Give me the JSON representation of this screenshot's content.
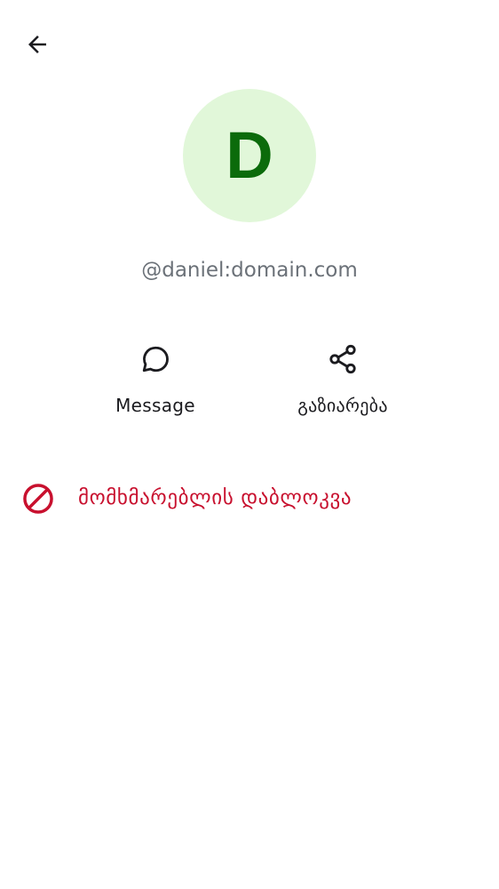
{
  "header": {
    "back_icon": "arrow-left-icon"
  },
  "colors": {
    "avatar_background": "#e1f7d9",
    "avatar_letter": "#0b6b0b",
    "user_id_text": "#6b7178",
    "danger": "#c8102e",
    "text_primary": "#1b1b1f"
  },
  "profile": {
    "avatar_initial": "D",
    "user_id": "@daniel:domain.com"
  },
  "actions": [
    {
      "icon": "chat-bubble-icon",
      "label": "Message"
    },
    {
      "icon": "share-icon",
      "label": "გაზიარება"
    }
  ],
  "block_user": {
    "icon": "block-icon",
    "label": "მომხმარებლის დაბლოკვა"
  }
}
